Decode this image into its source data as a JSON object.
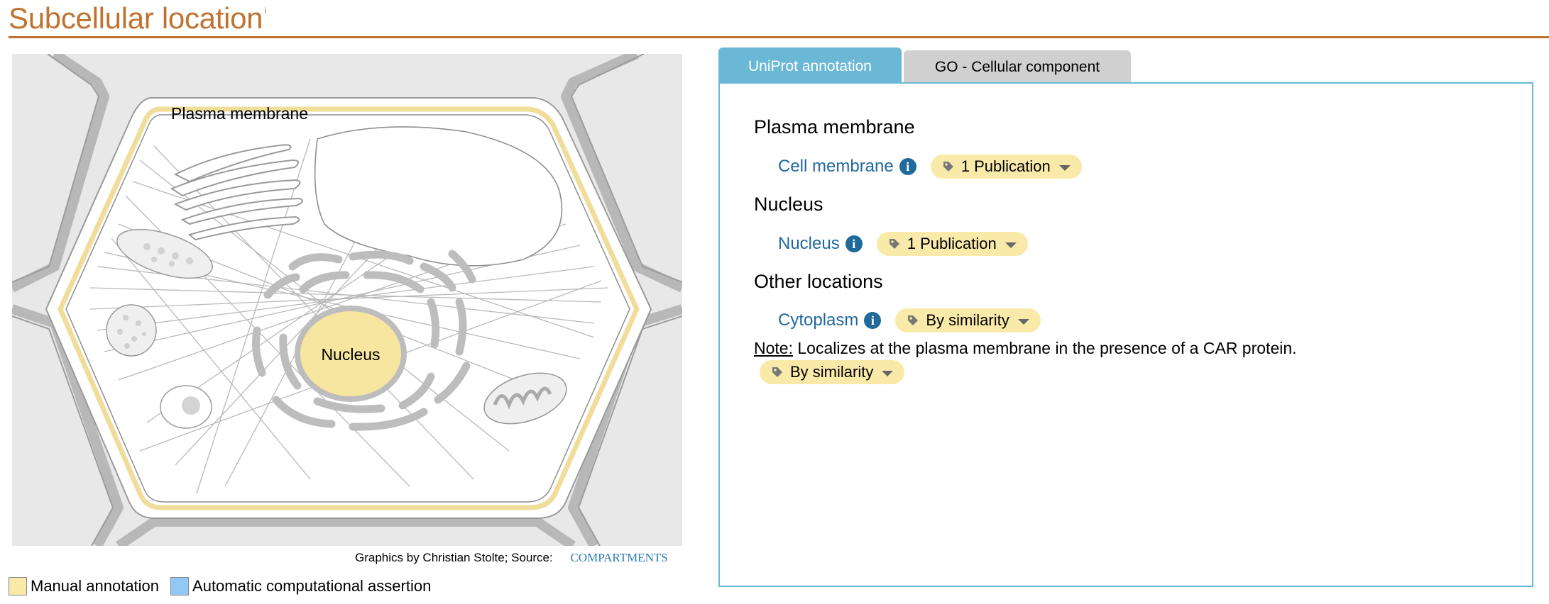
{
  "header": {
    "title": "Subcellular location",
    "info_marker": "i"
  },
  "figure": {
    "labels": {
      "plasma_membrane": "Plasma membrane",
      "nucleus": "Nucleus"
    },
    "credits_text": "Graphics by Christian Stolte; Source:",
    "credits_link": "COMPARTMENTS"
  },
  "legend": {
    "manual": "Manual annotation",
    "automatic": "Automatic computational assertion"
  },
  "colors": {
    "accent": "#c07230",
    "manual": "#faeaa9",
    "automatic": "#92c8f5",
    "tab_active": "#6ab8d6",
    "link": "#2068a0"
  },
  "tabs": [
    {
      "label": "UniProt annotation",
      "active": true
    },
    {
      "label": "GO - Cellular component",
      "active": false
    }
  ],
  "annotation": {
    "groups": [
      {
        "heading": "Plasma membrane",
        "location": "Cell membrane",
        "evidence": "1 Publication"
      },
      {
        "heading": "Nucleus",
        "location": "Nucleus",
        "evidence": "1 Publication"
      },
      {
        "heading": "Other locations",
        "location": "Cytoplasm",
        "evidence": "By similarity"
      }
    ],
    "note": {
      "label": "Note:",
      "text": "Localizes at the plasma membrane in the presence of a CAR protein.",
      "evidence": "By similarity"
    }
  }
}
